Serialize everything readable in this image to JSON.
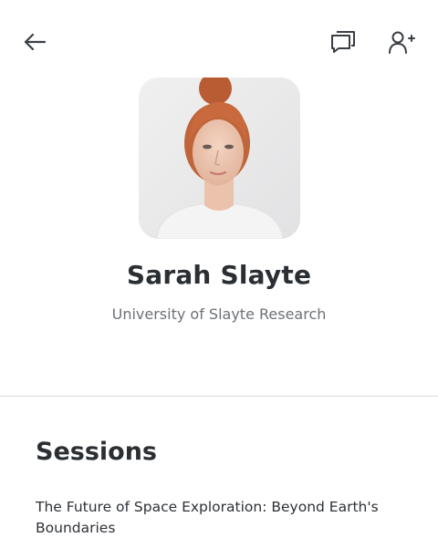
{
  "header": {
    "back_icon": "arrow-left-icon",
    "chat_icon": "chat-bubbles-icon",
    "follow_icon": "add-user-icon",
    "icon_color": "#3a3f45"
  },
  "profile": {
    "name": "Sarah Slayte",
    "affiliation": "University of Slayte Research"
  },
  "sessions": {
    "title": "Sessions",
    "items": [
      {
        "title": "The Future of Space Exploration: Beyond Earth's Boundaries"
      }
    ]
  }
}
